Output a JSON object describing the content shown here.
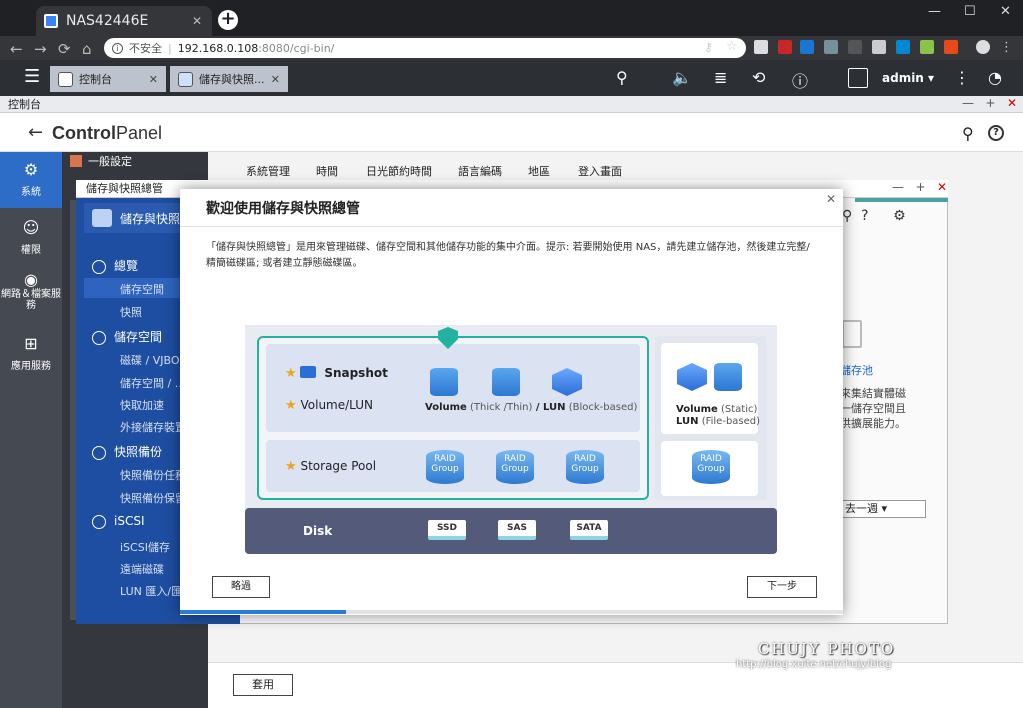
{
  "browser": {
    "tab_title": "NAS42446E",
    "new_tab": "+",
    "tab_close": "✕",
    "url_insecure": "不安全",
    "url_host": "192.168.0.108",
    "url_rest": ":8080/cgi-bin/",
    "win_min": "—",
    "win_max": "☐",
    "win_close": "✕"
  },
  "qts": {
    "tabs": [
      {
        "label": "控制台",
        "close": "✕"
      },
      {
        "label": "儲存與快照...",
        "close": "✕"
      }
    ],
    "user": "admin ▾",
    "menu_icon": "☰",
    "search_icon": "⚲",
    "more_icon": "⋮"
  },
  "control_panel": {
    "window_title": "控制台",
    "logo_bold": "Control",
    "logo_rest": "Panel",
    "window_controls": {
      "min": "—",
      "max": "+",
      "close": "✕"
    },
    "side_items": [
      {
        "label": "系統",
        "icon": "gear-icon"
      },
      {
        "label": "權限",
        "icon": "user-icon"
      },
      {
        "label": "網路＆檔案服務",
        "icon": "globe-icon"
      },
      {
        "label": "應用服務",
        "icon": "apps-icon"
      }
    ],
    "menu_items": [
      "一般設定",
      "儲存與快照總管"
    ],
    "tabs": [
      "系統管理",
      "時間",
      "日光節約時間",
      "語言編碼",
      "地區",
      "登入畫面"
    ],
    "apply": "套用"
  },
  "storage_window": {
    "title": "儲存與快照總管",
    "header": "儲存與快照",
    "nav": [
      {
        "label": "總覽",
        "group": true
      },
      {
        "label": "儲存空間",
        "group": false
      },
      {
        "label": "快照",
        "group": false
      },
      {
        "label": "儲存空間",
        "group": true
      },
      {
        "label": "磁碟 / VJBO",
        "group": false
      },
      {
        "label": "儲存空間 / ...",
        "group": false
      },
      {
        "label": "快取加速",
        "group": false
      },
      {
        "label": "外接儲存裝置",
        "group": false
      },
      {
        "label": "快照備份",
        "group": true
      },
      {
        "label": "快照備份任務",
        "group": false
      },
      {
        "label": "快照備份保留",
        "group": false
      },
      {
        "label": "iSCSI",
        "group": true
      },
      {
        "label": "iSCSI儲存",
        "group": false
      },
      {
        "label": "遠端磁碟",
        "group": false
      },
      {
        "label": "LUN 匯入/匯出",
        "group": false
      }
    ],
    "right_title": "儲存池",
    "right_text": [
      "來集結實體磁",
      "一儲存空間且",
      "供擴展能力。"
    ],
    "select_value": "去一週 ▾",
    "window_controls": {
      "min": "—",
      "max": "+",
      "close": "✕"
    }
  },
  "dialog": {
    "title": "歡迎使用儲存與快照總管",
    "close": "✕",
    "description": "「儲存與快照總管」是用來管理磁碟、儲存空間和其他儲存功能的集中介面。提示: 若要開始使用 NAS，請先建立儲存池，然後建立完整/精簡磁碟區; 或者建立靜態磁碟區。",
    "diagram": {
      "snapshot": "Snapshot",
      "volume_lun": "Volume/LUN",
      "volume_label_bold": "Volume",
      "volume_label_paren": " (Thick /Thin)",
      "lun_label_bold": " / LUN",
      "lun_label_paren": " (Block-based)",
      "storage_pool": "Storage Pool",
      "raid_group": "RAID Group",
      "static_volume_bold": "Volume",
      "static_volume_paren": " (Static)",
      "static_lun_bold": "LUN",
      "static_lun_paren": " (File-based)",
      "disk": "Disk",
      "disk_types": [
        "SSD",
        "SAS",
        "SATA"
      ]
    },
    "skip": "略過",
    "next": "下一步",
    "progress_fraction": 0.25
  },
  "watermark": {
    "title": "CHUJY PHOTO",
    "url": "http://blog.xuite.net/chujy/blog"
  }
}
